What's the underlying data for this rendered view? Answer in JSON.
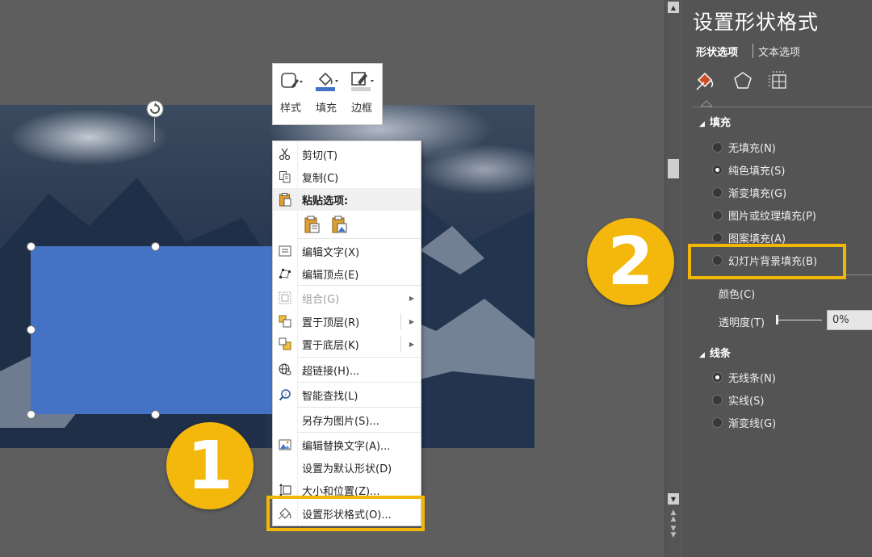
{
  "mini_toolbar": {
    "style_label": "样式",
    "fill_label": "填充",
    "border_label": "边框"
  },
  "context_menu": {
    "cut": "剪切(T)",
    "copy": "复制(C)",
    "paste_options": "粘贴选项:",
    "edit_text": "编辑文字(X)",
    "edit_points": "编辑顶点(E)",
    "group": "组合(G)",
    "bring_to_front": "置于顶层(R)",
    "send_to_back": "置于底层(K)",
    "hyperlink": "超链接(H)...",
    "smart_lookup": "智能查找(L)",
    "save_as_picture": "另存为图片(S)...",
    "edit_alt_text": "编辑替换文字(A)...",
    "set_default_shape": "设置为默认形状(D)",
    "size_position": "大小和位置(Z)...",
    "format_shape": "设置形状格式(O)..."
  },
  "format_pane": {
    "title": "设置形状格式",
    "tab_shape_options": "形状选项",
    "tab_text_options": "文本选项",
    "fill_section": "填充",
    "fill_options": [
      "无填充(N)",
      "纯色填充(S)",
      "渐变填充(G)",
      "图片或纹理填充(P)",
      "图案填充(A)",
      "幻灯片背景填充(B)"
    ],
    "fill_selected_index": 1,
    "color_label": "颜色(C)",
    "transparency_label": "透明度(T)",
    "transparency_value": "0%",
    "line_section": "线条",
    "line_options": [
      "无线条(N)",
      "实线(S)",
      "渐变线(G)"
    ],
    "line_selected_index": 0
  },
  "callouts": {
    "step1": "1",
    "step2": "2"
  },
  "colors": {
    "shape_fill": "#4472c4",
    "highlight": "#f2b705",
    "fill_bucket_icon": "#c94f2a"
  }
}
